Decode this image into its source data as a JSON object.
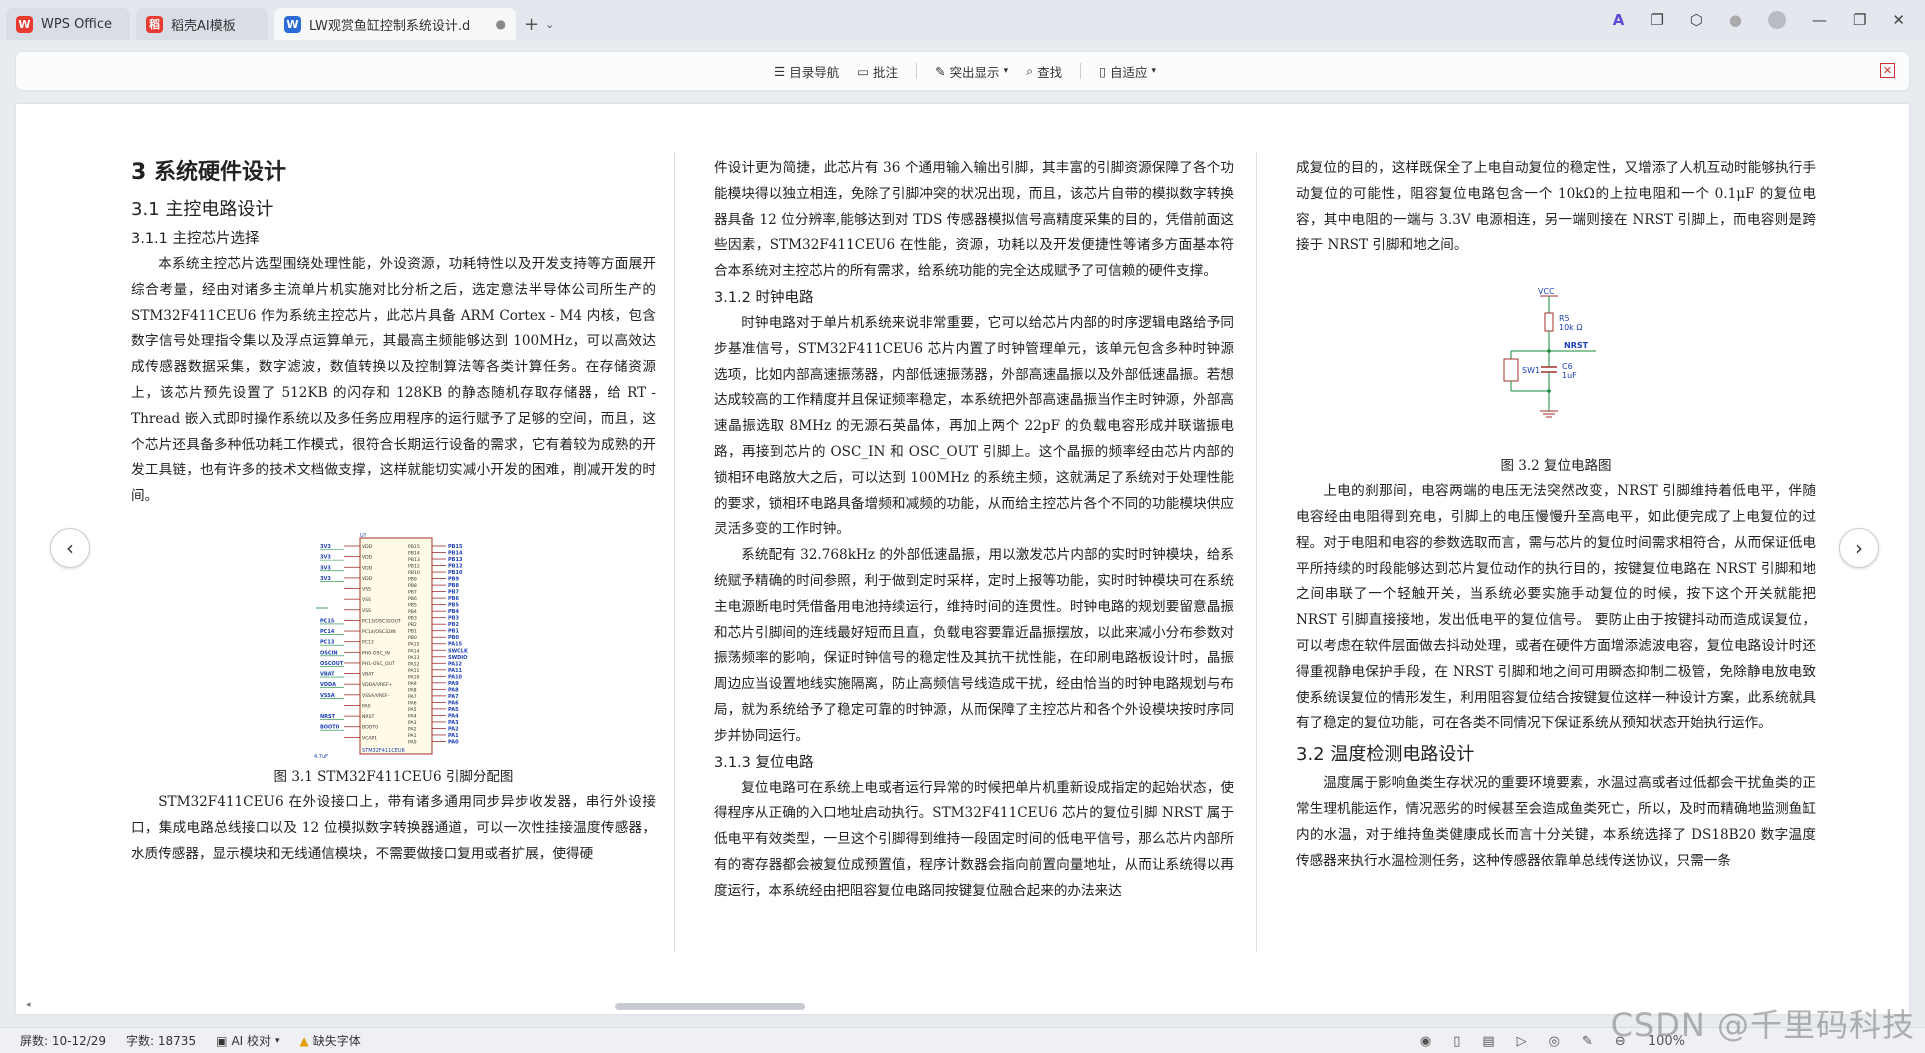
{
  "tabs": [
    {
      "label": "WPS Office",
      "icon": "wps-logo-icon",
      "color": "#e63b2e"
    },
    {
      "label": "稻壳AI模板",
      "icon": "docer-logo-icon",
      "color": "#e63b2e"
    },
    {
      "label": "LW观赏鱼缸控制系统设计.d",
      "icon": "word-doc-icon",
      "color": "#2b6cd6"
    }
  ],
  "toolbar": {
    "toc": "目录导航",
    "comment": "批注",
    "highlight": "突出显示",
    "find": "查找",
    "fit": "自适应"
  },
  "doc": {
    "col1": {
      "h1": "3  系统硬件设计",
      "h2": "3.1  主控电路设计",
      "h3": "3.1.1  主控芯片选择",
      "p1": "本系统主控芯片选型围绕处理性能，外设资源，功耗特性以及开发支持等方面展开综合考量，经由对诸多主流单片机实施对比分析之后，选定意法半导体公司所生产的 STM32F411CEU6 作为系统主控芯片，此芯片具备 ARM Cortex - M4 内核，包含数字信号处理指令集以及浮点运算单元，其最高主频能够达到 100MHz，可以高效达成传感器数据采集，数字滤波，数值转换以及控制算法等各类计算任务。在存储资源上，该芯片预先设置了 512KB 的闪存和 128KB 的静态随机存取存储器，给 RT - Thread 嵌入式即时操作系统以及多任务应用程序的运行赋予了足够的空间，而且，这个芯片还具备多种低功耗工作模式，很符合长期运行设备的需求，它有着较为成熟的开发工具链，也有许多的技术文档做支撑，这样就能切实减小开发的困难，削减开发的时间。",
      "fig_caption": "图 3.1  STM32F411CEU6 引脚分配图",
      "p2": "STM32F411CEU6 在外设接口上，带有诸多通用同步异步收发器，串行外设接口，集成电路总线接口以及 12 位模拟数字转换器通道，可以一次性挂接温度传感器，水质传感器，显示模块和无线通信模块，不需要做接口复用或者扩展，使得硬"
    },
    "col2": {
      "p0": "件设计更为简捷，此芯片有 36 个通用输入输出引脚，其丰富的引脚资源保障了各个功能模块得以独立相连，免除了引脚冲突的状况出现，而且，该芯片自带的模拟数字转换器具备 12 位分辨率,能够达到对 TDS 传感器模拟信号高精度采集的目的，凭借前面这些因素，STM32F411CEU6 在性能，资源，功耗以及开发便捷性等诸多方面基本符合本系统对主控芯片的所有需求，给系统功能的完全达成赋予了可信赖的硬件支撑。",
      "h3a": "3.1.2  时钟电路",
      "p1": "时钟电路对于单片机系统来说非常重要，它可以给芯片内部的时序逻辑电路给予同步基准信号，STM32F411CEU6 芯片内置了时钟管理单元，该单元包含多种时钟源选项，比如内部高速振荡器，内部低速振荡器，外部高速晶振以及外部低速晶振。若想达成较高的工作精度并且保证频率稳定，本系统把外部高速晶振当作主时钟源，外部高速晶振选取 8MHz 的无源石英晶体，再加上两个 22pF 的负载电容形成并联谐振电路，再接到芯片的 OSC_IN 和 OSC_OUT 引脚上。这个晶振的频率经由芯片内部的锁相环电路放大之后，可以达到 100MHz 的系统主频，这就满足了系统对于处理性能的要求，锁相环电路具备增频和减频的功能，从而给主控芯片各个不同的功能模块供应灵活多变的工作时钟。",
      "p2": "系统配有 32.768kHz 的外部低速晶振，用以激发芯片内部的实时时钟模块，给系统赋予精确的时间参照，利于做到定时采样，定时上报等功能，实时时钟模块可在系统主电源断电时凭借备用电池持续运行，维持时间的连贯性。时钟电路的规划要留意晶振和芯片引脚间的连线最好短而且直，负载电容要靠近晶振摆放，以此来减小分布参数对振荡频率的影响，保证时钟信号的稳定性及其抗干扰性能，在印刷电路板设计时，晶振周边应当设置地线实施隔离，防止高频信号线造成干扰，经由恰当的时钟电路规划与布局，就为系统给予了稳定可靠的时钟源，从而保障了主控芯片和各个外设模块按时序同步并协同运行。",
      "h3b": "3.1.3  复位电路",
      "p3": "复位电路可在系统上电或者运行异常的时候把单片机重新设成指定的起始状态，使得程序从正确的入口地址启动执行。STM32F411CEU6 芯片的复位引脚 NRST 属于低电平有效类型，一旦这个引脚得到维持一段固定时间的低电平信号，那么芯片内部所有的寄存器都会被复位成预置值，程序计数器会指向前置向量地址，从而让系统得以再度运行，本系统经由把阻容复位电路同按键复位融合起来的办法来达"
    },
    "col3": {
      "p0": "成复位的目的，这样既保全了上电自动复位的稳定性，又增添了人机互动时能够执行手动复位的可能性，阻容复位电路包含一个 10kΩ的上拉电阻和一个 0.1μF 的复位电容，其中电阻的一端与 3.3V 电源相连，另一端则接在 NRST 引脚上，而电容则是跨接于 NRST 引脚和地之间。",
      "fig_caption": "图 3.2  复位电路图",
      "p1": "上电的刹那间，电容两端的电压无法突然改变，NRST 引脚维持着低电平，伴随电容经由电阻得到充电，引脚上的电压慢慢升至高电平，如此便完成了上电复位的过程。对于电阻和电容的参数选取而言，需与芯片的复位时间需求相符合，从而保证低电平所持续的时段能够达到芯片复位动作的执行目的，按键复位电路在 NRST 引脚和地之间串联了一个轻触开关，当系统必要实施手动复位的时候，按下这个开关就能把 NRST 引脚直接接地，发出低电平的复位信号。 要防止由于按键抖动而造成误复位，可以考虑在软件层面做去抖动处理，或者在硬件方面增添滤波电容，复位电路设计时还得重视静电保护手段，在 NRST 引脚和地之间可用瞬态抑制二极管，免除静电放电致使系统误复位的情形发生，利用阻容复位结合按键复位这样一种设计方案，此系统就具有了稳定的复位功能，可在各类不同情况下保证系统从预知状态开始执行运作。",
      "h2": "3.2  温度检测电路设计",
      "p2": "温度属于影响鱼类生存状况的重要环境要素，水温过高或者过低都会干扰鱼类的正常生理机能运作，情况恶劣的时候甚至会造成鱼类死亡，所以，及时而精确地监测鱼缸内的水温，对于维持鱼类健康成长而言十分关键，本系统选择了 DS18B20 数字温度传感器来执行水温检测任务，这种传感器依靠单总线传送协议，只需一条"
    },
    "schematic": {
      "chip": "U?",
      "chip_name": "STM32F411CEU6",
      "left_pins": [
        "VDD",
        "VDD",
        "VDD",
        "VDD",
        "VSS",
        "VSS",
        "VSS",
        "PC13/OSC32OUT",
        "PC14/OSC32IN",
        "PC13",
        "PH0-OSC_IN",
        "PH1-OSC_OUT",
        "VBAT",
        "VDDA/VREF+",
        "VSSA/VREF-",
        "PA0",
        "NRST",
        "BOOT0",
        "VCAP1"
      ],
      "right_pins": [
        "PB15",
        "PB14",
        "PB13",
        "PB12",
        "PB10",
        "PB9",
        "PB8",
        "PB7",
        "PB6",
        "PB5",
        "PB4",
        "PB3",
        "PB2",
        "PB1",
        "PB0",
        "PA15",
        "PA14",
        "PA13",
        "PA12",
        "PA11",
        "PA10",
        "PA9",
        "PA8",
        "PA7",
        "PA6",
        "PA5",
        "PA4",
        "PA3",
        "PA2",
        "PA1",
        "PA0"
      ],
      "left_nets": [
        "3V3",
        "3V3",
        "3V3",
        "3V3",
        "",
        "",
        "",
        "PC15",
        "PC14",
        "PC13",
        "OSCIN",
        "OSCOUT",
        "VBAT",
        "VDDA",
        "VSSA",
        "",
        "NRST",
        "BOOT0",
        ""
      ],
      "right_nets": [
        "PB15",
        "PB14",
        "PB13",
        "PB12",
        "PB10",
        "PB9",
        "PB8",
        "PB7",
        "PB6",
        "PB5",
        "PB4",
        "PB3",
        "PB2",
        "PB1",
        "PB0",
        "PA15",
        "SWCLK",
        "SWDIO",
        "PA12",
        "PA11",
        "PA10",
        "PA9",
        "PA8",
        "PA7",
        "PA6",
        "PA5",
        "PA4",
        "PA3",
        "PA2",
        "PA1",
        "PA0"
      ],
      "cap_label": "4.7uF"
    },
    "reset_schematic": {
      "vcc": "VCC",
      "r_label": "R5",
      "r_value": "10k Ω",
      "net": "NRST",
      "sw": "SW1",
      "c_label": "C6",
      "c_value": "1uF"
    }
  },
  "status": {
    "pages": "屏数: 10-12/29",
    "words": "字数: 18735",
    "ai": "AI 校对",
    "font": "缺失字体",
    "zoom": "100%"
  },
  "watermark": "CSDN @千里码科技"
}
